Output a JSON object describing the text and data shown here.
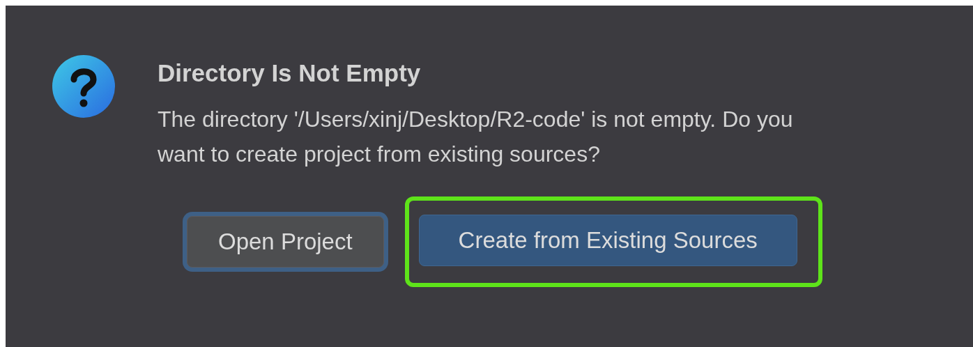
{
  "dialog": {
    "title": "Directory Is Not Empty",
    "message": "The directory '/Users/xinj/Desktop/R2-code' is not empty. Do you want to create project from existing sources?",
    "buttons": [
      {
        "label": "Open Project",
        "kind": "secondary",
        "focused": true,
        "highlighted": false
      },
      {
        "label": "Create from Existing Sources",
        "kind": "primary",
        "focused": false,
        "highlighted": true
      }
    ]
  }
}
